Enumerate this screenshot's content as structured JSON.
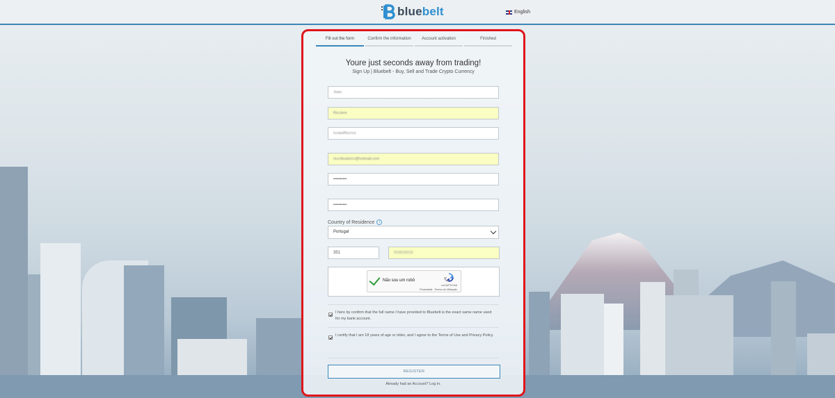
{
  "header": {
    "brand_part1": "blue",
    "brand_part2": "belt",
    "language": "English",
    "flag_icon": "uk-flag-icon"
  },
  "steps": [
    {
      "label": "Fill out the form",
      "active": true
    },
    {
      "label": "Confirm the information",
      "active": false
    },
    {
      "label": "Account activation",
      "active": false
    },
    {
      "label": "Finished",
      "active": false
    }
  ],
  "form": {
    "heading": "Youre just seconds away from trading!",
    "subheading": "Sign Up | Bluebelt - Buy, Sell and Trade Crypto Currency",
    "first_name": "Joao",
    "last_name": "Ricciere",
    "username": "IcciaoRiccrco",
    "email": "riccribvalorrc@hotmail.com",
    "password": "••••••••••",
    "password_confirm": "••••••••••",
    "country_label": "Country of Residence",
    "country_value": "Portugal",
    "phone_code": "351",
    "phone_number": "910019210",
    "captcha": {
      "label": "Não sou um robô",
      "brand": "reCAPTCHA",
      "terms": "Privacidade - Termos de Utilização"
    },
    "confirm_name_text": "I here by confirm that the full name I have provided to Bluebelt is the exact same name used for my bank account.",
    "confirm_age_text": "I certify that I am 18 years of age or older, and I agree to the Terms of Use and Privacy Policy.",
    "register_label": "REGISTER",
    "login_text": "Already had an Account? Log in."
  },
  "colors": {
    "accent": "#3a87b8",
    "highlight_border": "#e0151b",
    "autofill_yellow": "#fafec2"
  }
}
